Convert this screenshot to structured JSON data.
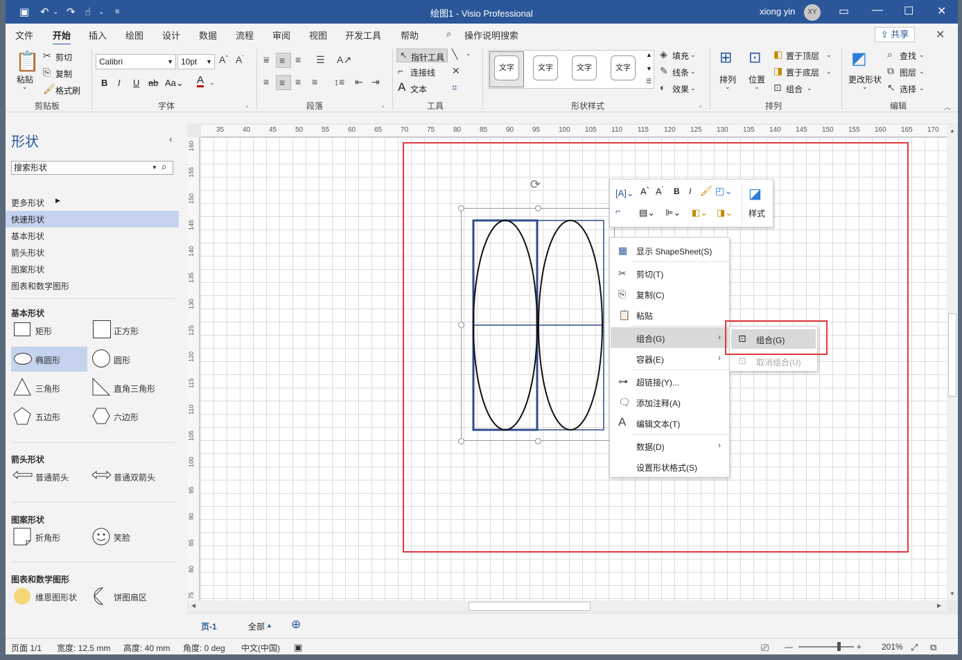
{
  "window": {
    "title": "绘图1 - Visio Professional",
    "user": "xiong yin",
    "avatar_initials": "XY"
  },
  "menu_tabs": [
    "文件",
    "开始",
    "插入",
    "绘图",
    "设计",
    "数据",
    "流程",
    "审阅",
    "视图",
    "开发工具",
    "帮助"
  ],
  "menu_search": "操作说明搜索",
  "share_label": "共享",
  "ribbon": {
    "clipboard": {
      "paste": "粘贴",
      "cut": "剪切",
      "copy": "复制",
      "format_painter": "格式刷",
      "label": "剪贴板"
    },
    "font": {
      "font_name": "Calibri",
      "font_size": "10pt",
      "label": "字体"
    },
    "paragraph": {
      "label": "段落"
    },
    "tools": {
      "pointer": "指针工具",
      "connector": "连接线",
      "text": "文本",
      "label": "工具"
    },
    "shape_styles": {
      "swatch": "文字",
      "fill": "填充",
      "line": "线条",
      "effects": "效果",
      "label": "形状样式"
    },
    "arrange": {
      "align": "排列",
      "position": "位置",
      "bring_front": "置于顶层",
      "send_back": "置于底层",
      "group": "组合",
      "label": "排列"
    },
    "edit": {
      "change_shape": "更改形状",
      "find": "查找",
      "layers": "图层",
      "select": "选择",
      "label": "编辑"
    }
  },
  "shapes_panel": {
    "title": "形状",
    "search_placeholder": "搜索形状",
    "more_shapes": "更多形状",
    "stencils": [
      "快速形状",
      "基本形状",
      "箭头形状",
      "图案形状",
      "图表和数学图形"
    ],
    "sections": {
      "basic": {
        "title": "基本形状",
        "items": [
          "矩形",
          "正方形",
          "椭圆形",
          "圆形",
          "三角形",
          "直角三角形",
          "五边形",
          "六边形"
        ]
      },
      "arrow": {
        "title": "箭头形状",
        "items": [
          "普通箭头",
          "普通双箭头"
        ]
      },
      "pattern": {
        "title": "图案形状",
        "items": [
          "折角形",
          "笑脸"
        ]
      },
      "chart": {
        "title": "图表和数学图形",
        "items": [
          "维恩图形状",
          "饼图扇区"
        ]
      }
    }
  },
  "ruler": {
    "h_ticks": [
      "35",
      "40",
      "45",
      "50",
      "55",
      "60",
      "65",
      "70",
      "75",
      "80",
      "85",
      "90",
      "95",
      "100",
      "105",
      "110",
      "115",
      "120",
      "125",
      "130",
      "135",
      "140",
      "145",
      "150",
      "155",
      "160",
      "165",
      "170"
    ],
    "v_ticks": [
      "160",
      "155",
      "150",
      "145",
      "140",
      "135",
      "130",
      "125",
      "120",
      "115",
      "110",
      "105",
      "100",
      "95",
      "90",
      "85",
      "80",
      "75"
    ]
  },
  "mini_toolbar": {
    "style_label": "样式"
  },
  "context_menu": {
    "items": [
      {
        "label": "显示 ShapeSheet(S)"
      },
      {
        "label": "剪切(T)"
      },
      {
        "label": "复制(C)"
      },
      {
        "label": "粘贴"
      },
      {
        "label": "组合(G)"
      },
      {
        "label": "容器(E)"
      },
      {
        "label": "超链接(Y)..."
      },
      {
        "label": "添加注释(A)"
      },
      {
        "label": "编辑文本(T)"
      },
      {
        "label": "数据(D)"
      },
      {
        "label": "设置形状格式(S)"
      }
    ],
    "submenu": [
      {
        "label": "组合(G)"
      },
      {
        "label": "取消组合(U)"
      }
    ]
  },
  "page_tabs": {
    "page": "页-1",
    "all": "全部"
  },
  "status": {
    "page": "页面 1/1",
    "width": "宽度: 12.5 mm",
    "height": "高度: 40 mm",
    "angle": "角度: 0 deg",
    "language": "中文(中国)",
    "zoom": "201%"
  },
  "colors": {
    "accent": "#2b579a",
    "highlight_box": "#e0383e",
    "selected_stencil": "#c5d3ee"
  }
}
